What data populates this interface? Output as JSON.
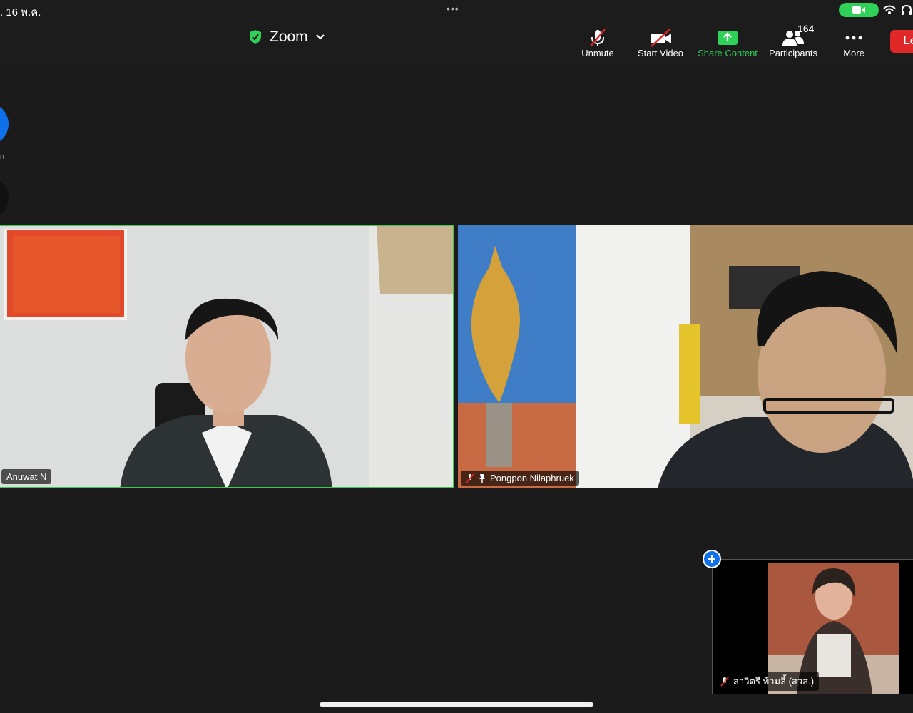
{
  "status_bar": {
    "date": ". 16 พ.ค.",
    "more_dots": "•••",
    "camera_color": "#2fd158"
  },
  "meeting": {
    "title": "Zoom",
    "shield_icon": "green-shield-check"
  },
  "toolbar": {
    "unmute_label": "Unmute",
    "start_video_label": "Start Video",
    "share_content_label": "Share Content",
    "participants_label": "Participants",
    "participants_count": "164",
    "more_label": "More",
    "leave_label": "Le"
  },
  "left_panel": {
    "label": "n"
  },
  "videos": [
    {
      "name": "Anuwat N",
      "muted": true
    },
    {
      "name": "Pongpon Nilaphruek",
      "muted": true,
      "pinned": true
    }
  ],
  "self_view": {
    "name": "สาวิตรี ท้วมลี้ (สวส.)",
    "muted": true
  },
  "colors": {
    "accent_green": "#2fd158",
    "active_speaker_border": "#3ec94b",
    "leave_red": "#e02828",
    "zoom_blue": "#0e71eb"
  }
}
